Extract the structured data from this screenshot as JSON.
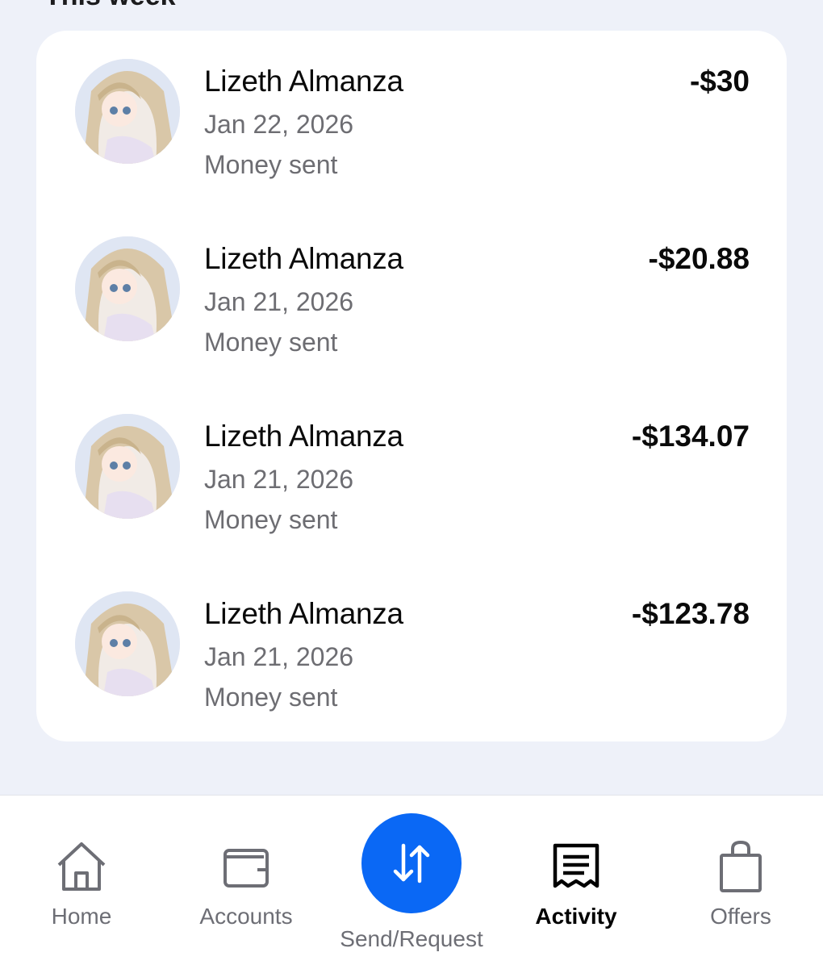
{
  "section": {
    "title": "This week"
  },
  "transactions": [
    {
      "name": "Lizeth Almanza",
      "date": "Jan 22, 2026",
      "status": "Money sent",
      "amount": "-$30"
    },
    {
      "name": "Lizeth Almanza",
      "date": "Jan 21, 2026",
      "status": "Money sent",
      "amount": "-$20.88"
    },
    {
      "name": "Lizeth Almanza",
      "date": "Jan 21, 2026",
      "status": "Money sent",
      "amount": "-$134.07"
    },
    {
      "name": "Lizeth Almanza",
      "date": "Jan 21, 2026",
      "status": "Money sent",
      "amount": "-$123.78"
    }
  ],
  "nav": {
    "home": {
      "label": "Home",
      "icon": "home-icon"
    },
    "accounts": {
      "label": "Accounts",
      "icon": "wallet-icon"
    },
    "send_request": {
      "label": "Send/Request",
      "icon": "swap-arrows-icon"
    },
    "activity": {
      "label": "Activity",
      "icon": "receipt-icon",
      "active": true
    },
    "offers": {
      "label": "Offers",
      "icon": "shopping-bag-icon"
    }
  },
  "colors": {
    "background": "#eef1f9",
    "card": "#ffffff",
    "accent": "#0a68f5",
    "secondary_text": "#6d6d72"
  }
}
